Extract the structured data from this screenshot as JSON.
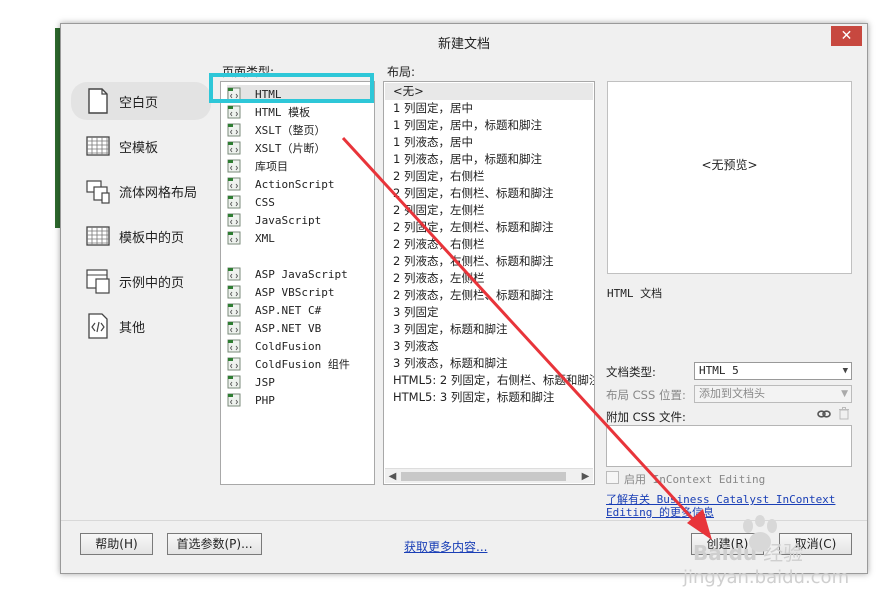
{
  "dialog": {
    "title": "新建文档",
    "close_glyph": "✕"
  },
  "categories": [
    {
      "label": "空白页",
      "icon": "blank-page-icon",
      "selected": true
    },
    {
      "label": "空模板",
      "icon": "blank-template-icon",
      "selected": false
    },
    {
      "label": "流体网格布局",
      "icon": "fluid-grid-icon",
      "selected": false
    },
    {
      "label": "模板中的页",
      "icon": "template-page-icon",
      "selected": false
    },
    {
      "label": "示例中的页",
      "icon": "sample-page-icon",
      "selected": false
    },
    {
      "label": "其他",
      "icon": "code-icon",
      "selected": false
    }
  ],
  "page_type": {
    "label": "页面类型:",
    "items": [
      "HTML",
      "HTML 模板",
      "XSLT（整页）",
      "XSLT（片断）",
      "库项目",
      "ActionScript",
      "CSS",
      "JavaScript",
      "XML",
      "ASP JavaScript",
      "ASP VBScript",
      "ASP.NET C#",
      "ASP.NET VB",
      "ColdFusion",
      "ColdFusion 组件",
      "JSP",
      "PHP"
    ],
    "selected_index": 0
  },
  "layout": {
    "label": "布局:",
    "items": [
      "<无>",
      "1 列固定，居中",
      "1 列固定，居中，标题和脚注",
      "1 列液态，居中",
      "1 列液态，居中，标题和脚注",
      "2 列固定，右侧栏",
      "2 列固定，右侧栏、标题和脚注",
      "2 列固定，左侧栏",
      "2 列固定，左侧栏、标题和脚注",
      "2 列液态，右侧栏",
      "2 列液态，右侧栏、标题和脚注",
      "2 列液态，左侧栏",
      "2 列液态，左侧栏、标题和脚注",
      "3 列固定",
      "3 列固定，标题和脚注",
      "3 列液态",
      "3 列液态，标题和脚注",
      "HTML5: 2 列固定，右侧栏、标题和脚注",
      "HTML5: 3 列固定，标题和脚注"
    ],
    "selected_index": 0
  },
  "preview": {
    "placeholder": "<无预览>",
    "description": "HTML 文档"
  },
  "options": {
    "doctype_label": "文档类型:",
    "doctype_value": "HTML 5",
    "css_position_label": "布局 CSS 位置:",
    "css_position_value": "添加到文档头",
    "attach_css_label": "附加 CSS 文件:",
    "incontext_label": "启用 InContext Editing",
    "bc_link": "了解有关 Business Catalyst InContext Editing 的更多信息"
  },
  "footer": {
    "help": "帮助(H)",
    "preferences": "首选参数(P)...",
    "more_content": "获取更多内容...",
    "create": "创建(R)",
    "cancel": "取消(C)"
  },
  "watermark": {
    "brand": "Baidu",
    "brand_suffix": "经验",
    "url": "jingyan.baidu.com"
  },
  "colors": {
    "highlight_box": "#2ec7d8",
    "arrow": "#e8343a",
    "link": "#1a3fb6"
  }
}
